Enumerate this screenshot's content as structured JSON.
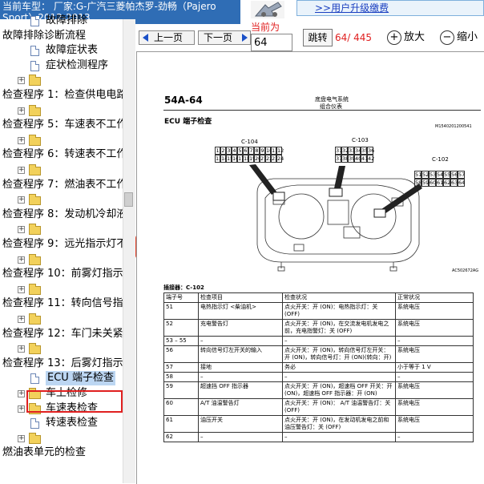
{
  "header": {
    "car_model": "当前车型： 厂家:G-广汽三菱帕杰罗-劲畅（Pajero Sport）2012-2013",
    "upgrade_link": ">>用户升级缴费"
  },
  "toolbar": {
    "prev_label": "上一页",
    "next_label": "下一页",
    "current_label": "当前为",
    "page_value": "64",
    "jump_label": "跳转",
    "page_count": "64/ 445",
    "zoom_in_label": "放大",
    "zoom_out_label": "缩小"
  },
  "sidebar": {
    "items": [
      {
        "label": "故障排除",
        "kind": "doc",
        "level": 2
      },
      {
        "label": "故障排除诊断流程",
        "kind": "text",
        "level": 0
      },
      {
        "label": "故障症状表",
        "kind": "doc",
        "level": 2
      },
      {
        "label": "症状检测程序",
        "kind": "doc",
        "level": 2
      },
      {
        "label": "",
        "kind": "folder",
        "level": 1
      },
      {
        "label": "检查程序 1：检查供电电路",
        "kind": "text",
        "level": 0
      },
      {
        "label": "",
        "kind": "folder",
        "level": 1
      },
      {
        "label": "检查程序 5：车速表不工作",
        "kind": "text",
        "level": 0
      },
      {
        "label": "",
        "kind": "folder",
        "level": 1
      },
      {
        "label": "检查程序 6：转速表不工作",
        "kind": "text",
        "level": 0
      },
      {
        "label": "",
        "kind": "folder",
        "level": 1
      },
      {
        "label": "检查程序 7：燃油表不工作",
        "kind": "text",
        "level": 0
      },
      {
        "label": "",
        "kind": "folder",
        "level": 1
      },
      {
        "label": "检查程序 8：发动机冷却液",
        "kind": "text",
        "level": 0
      },
      {
        "label": "",
        "kind": "folder",
        "level": 1
      },
      {
        "label": "检查程序 9：远光指示灯不",
        "kind": "text",
        "level": 0
      },
      {
        "label": "",
        "kind": "folder",
        "level": 1
      },
      {
        "label": "检查程序 10：前雾灯指示",
        "kind": "text",
        "level": 0
      },
      {
        "label": "",
        "kind": "folder",
        "level": 1
      },
      {
        "label": "检查程序 11：转向信号指",
        "kind": "text",
        "level": 0
      },
      {
        "label": "",
        "kind": "folder",
        "level": 1
      },
      {
        "label": "检查程序 12：车门未关紧",
        "kind": "text",
        "level": 0
      },
      {
        "label": "",
        "kind": "folder",
        "level": 1
      },
      {
        "label": "检查程序 13：后雾灯指示",
        "kind": "text",
        "level": 0
      },
      {
        "label": "ECU 端子检查",
        "kind": "doc",
        "level": 2,
        "selected": true
      },
      {
        "label": "车上检修",
        "kind": "folder",
        "level": 1
      },
      {
        "label": "车速表检查",
        "kind": "folder",
        "level": 1
      },
      {
        "label": "转速表检查",
        "kind": "doc",
        "level": 2
      },
      {
        "label": "",
        "kind": "folder",
        "level": 1
      },
      {
        "label": "燃油表单元的检查",
        "kind": "text",
        "level": 0
      }
    ]
  },
  "document": {
    "page_number": "54A-64",
    "section_title": "底盘电气系统",
    "section_subtitle": "组合仪表",
    "heading": "ECU 端子检查",
    "figure_code": "M1540201200541",
    "figure_ref": "AC502672AG",
    "connector_c104": "C-104",
    "connector_c103": "C-103",
    "connector_c102": "C-102",
    "c104_row1": [
      "1",
      "2",
      "3",
      "4",
      "5",
      "6",
      "7",
      "8",
      "9",
      "10",
      "11",
      "12"
    ],
    "c104_row2": [
      "13",
      "14",
      "15",
      "16",
      "17",
      "18",
      "19",
      "20",
      "21",
      "22",
      "23",
      "24"
    ],
    "c103_row1": [
      "31",
      "32",
      "33",
      "34",
      "35",
      "36"
    ],
    "c103_row2": [
      "37",
      "38",
      "39",
      "40",
      "41",
      "42"
    ],
    "c102_row1": [
      "51",
      "52",
      "53",
      "54",
      "55",
      "56",
      "57"
    ],
    "c102_row2": [
      "58",
      "59",
      "60",
      "61",
      "62",
      "63",
      "64"
    ],
    "table_caption": "插接器：C-102",
    "table_headers": [
      "端子号",
      "检查项目",
      "检查状况",
      "正常状况"
    ],
    "table_rows": [
      [
        "51",
        "电热指示灯 <柴油机>",
        "点火开关：开 (ON)：电热指示灯：关 (OFF)",
        "系统电压"
      ],
      [
        "52",
        "充电警告灯",
        "点火开关：开 (ON)，在交流发电机发电之前，充电指警灯：关 (OFF)",
        "系统电压"
      ],
      [
        "53 – 55",
        "–",
        "–",
        "–"
      ],
      [
        "56",
        "转向信号灯左开关的输入",
        "点火开关：开 (ON)，转向信号灯左开关：开 (ON)，转向信号灯：开 (ON)(转向：开)",
        "系统电压"
      ],
      [
        "57",
        "接地",
        "务必",
        "小于等于 1 V"
      ],
      [
        "58",
        "–",
        "–",
        "–"
      ],
      [
        "59",
        "超速挡 OFF 指示器",
        "点火开关：开 (ON)，超速档 OFF 开关：开 (ON)，超速档 OFF 指示器：开 (ON)",
        "系统电压"
      ],
      [
        "60",
        "A/T 油温警告灯",
        "点火开关：开 (ON)： A/T 油温警告灯：关 (OFF)",
        "系统电压"
      ],
      [
        "61",
        "油压开关",
        "点火开关：开 (ON)，在发动机发电之前和油压警告灯：关 (OFF)",
        "系统电压"
      ],
      [
        "62",
        "–",
        "–",
        "–"
      ]
    ]
  },
  "colors": {
    "title_bar": "#2f6db5",
    "nav_arrow": "#1a50c8",
    "alert_text": "#e02020",
    "search_button": "#e8432b",
    "selection_fill": "#bcd6f2"
  }
}
